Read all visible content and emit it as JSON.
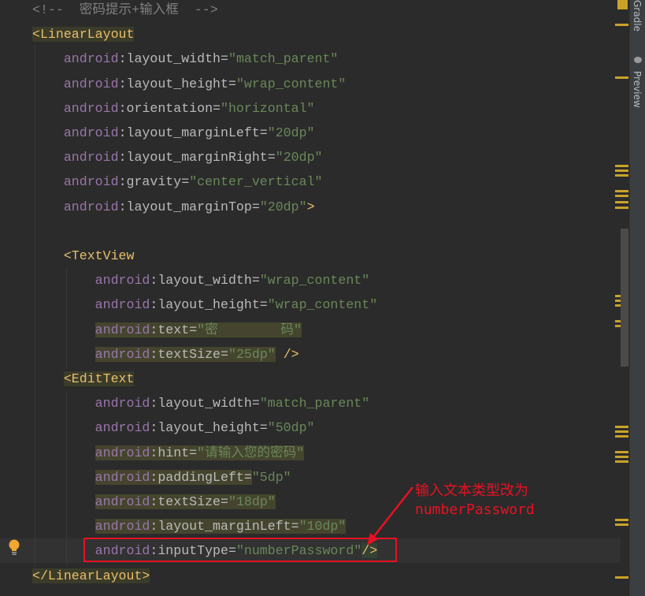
{
  "code": {
    "lines": [
      {
        "tokens": [
          {
            "t": "<!--  密码提示+输入框  -->",
            "c": "comment"
          }
        ]
      },
      {
        "tokens": [
          {
            "t": "<LinearLayout",
            "c": "tag tagbg"
          }
        ]
      },
      {
        "tokens": [
          {
            "t": "    "
          },
          {
            "t": "android",
            "c": "ns"
          },
          {
            "t": ":layout_width=",
            "c": "attr"
          },
          {
            "t": "\"match_parent\"",
            "c": "val"
          }
        ]
      },
      {
        "tokens": [
          {
            "t": "    "
          },
          {
            "t": "android",
            "c": "ns"
          },
          {
            "t": ":layout_height=",
            "c": "attr"
          },
          {
            "t": "\"wrap_content\"",
            "c": "val"
          }
        ]
      },
      {
        "tokens": [
          {
            "t": "    "
          },
          {
            "t": "android",
            "c": "ns"
          },
          {
            "t": ":orientation=",
            "c": "attr"
          },
          {
            "t": "\"horizontal\"",
            "c": "val"
          }
        ]
      },
      {
        "tokens": [
          {
            "t": "    "
          },
          {
            "t": "android",
            "c": "ns"
          },
          {
            "t": ":layout_marginLeft=",
            "c": "attr"
          },
          {
            "t": "\"20dp\"",
            "c": "val"
          }
        ]
      },
      {
        "tokens": [
          {
            "t": "    "
          },
          {
            "t": "android",
            "c": "ns"
          },
          {
            "t": ":layout_marginRight=",
            "c": "attr"
          },
          {
            "t": "\"20dp\"",
            "c": "val"
          }
        ]
      },
      {
        "tokens": [
          {
            "t": "    "
          },
          {
            "t": "android",
            "c": "ns"
          },
          {
            "t": ":gravity=",
            "c": "attr"
          },
          {
            "t": "\"center_vertical\"",
            "c": "val"
          }
        ]
      },
      {
        "tokens": [
          {
            "t": "    "
          },
          {
            "t": "android",
            "c": "ns"
          },
          {
            "t": ":layout_marginTop=",
            "c": "attr"
          },
          {
            "t": "\"20dp\"",
            "c": "val"
          },
          {
            "t": ">",
            "c": "tag"
          }
        ]
      },
      {
        "tokens": [
          {
            "t": ""
          }
        ]
      },
      {
        "tokens": [
          {
            "t": "    "
          },
          {
            "t": "<TextView",
            "c": "tag"
          }
        ]
      },
      {
        "tokens": [
          {
            "t": "        "
          },
          {
            "t": "android",
            "c": "ns"
          },
          {
            "t": ":layout_width=",
            "c": "attr"
          },
          {
            "t": "\"wrap_content\"",
            "c": "val"
          }
        ]
      },
      {
        "tokens": [
          {
            "t": "        "
          },
          {
            "t": "android",
            "c": "ns"
          },
          {
            "t": ":layout_height=",
            "c": "attr"
          },
          {
            "t": "\"wrap_content\"",
            "c": "val"
          }
        ]
      },
      {
        "tokens": [
          {
            "t": "        "
          },
          {
            "t": "android",
            "c": "ns h"
          },
          {
            "t": ":text=",
            "c": "attr h"
          },
          {
            "t": "\"密        码\"",
            "c": "val h"
          }
        ]
      },
      {
        "tokens": [
          {
            "t": "        "
          },
          {
            "t": "android",
            "c": "ns h"
          },
          {
            "t": ":textSize=",
            "c": "attr h"
          },
          {
            "t": "\"25dp\"",
            "c": "val h"
          },
          {
            "t": " />",
            "c": "tag"
          }
        ]
      },
      {
        "tokens": [
          {
            "t": "    "
          },
          {
            "t": "<EditText",
            "c": "tag tagbg"
          }
        ]
      },
      {
        "tokens": [
          {
            "t": "        "
          },
          {
            "t": "android",
            "c": "ns"
          },
          {
            "t": ":layout_width=",
            "c": "attr"
          },
          {
            "t": "\"match_parent\"",
            "c": "val"
          }
        ]
      },
      {
        "tokens": [
          {
            "t": "        "
          },
          {
            "t": "android",
            "c": "ns"
          },
          {
            "t": ":layout_height=",
            "c": "attr"
          },
          {
            "t": "\"50dp\"",
            "c": "val"
          }
        ]
      },
      {
        "tokens": [
          {
            "t": "        "
          },
          {
            "t": "android",
            "c": "ns h"
          },
          {
            "t": ":hint=",
            "c": "attr h"
          },
          {
            "t": "\"请输入您的密码\"",
            "c": "val h"
          }
        ]
      },
      {
        "tokens": [
          {
            "t": "        "
          },
          {
            "t": "android",
            "c": "ns h"
          },
          {
            "t": ":paddingLeft=",
            "c": "attr h"
          },
          {
            "t": "\"5dp\"",
            "c": "val"
          }
        ]
      },
      {
        "tokens": [
          {
            "t": "        "
          },
          {
            "t": "android",
            "c": "ns h"
          },
          {
            "t": ":textSize=",
            "c": "attr h"
          },
          {
            "t": "\"18dp\"",
            "c": "val h"
          }
        ]
      },
      {
        "tokens": [
          {
            "t": "        "
          },
          {
            "t": "android",
            "c": "ns h"
          },
          {
            "t": ":layout_marginLeft=",
            "c": "attr h"
          },
          {
            "t": "\"10dp\"",
            "c": "val h"
          }
        ]
      },
      {
        "tokens": [
          {
            "t": "        "
          },
          {
            "t": "android",
            "c": "ns"
          },
          {
            "t": ":inputType=",
            "c": "attr"
          },
          {
            "t": "\"numberPassword\"",
            "c": "val"
          },
          {
            "t": "/>",
            "c": "sel"
          }
        ]
      },
      {
        "tokens": [
          {
            "t": "</LinearLayout>",
            "c": "tag tagbg"
          }
        ]
      }
    ]
  },
  "annotation": {
    "line1": "输入文本类型改为",
    "line2": "numberPassword",
    "color": "#e81123"
  },
  "sidebar": {
    "gradle_label": "Gradle",
    "preview_label": "Preview"
  },
  "icons": {
    "bulb": "lightbulb-icon",
    "preview": "eye-icon"
  }
}
